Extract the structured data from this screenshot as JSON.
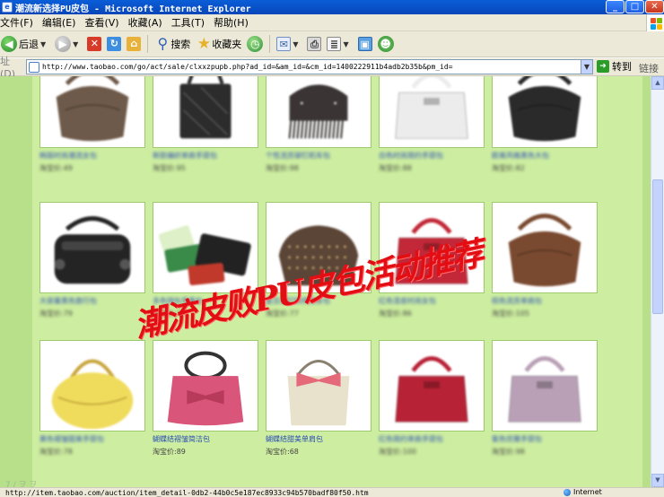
{
  "window": {
    "title": "潮流新选择PU皮包 - Microsoft Internet Explorer",
    "controls": {
      "minimize": "_",
      "maximize": "□",
      "close": "✕"
    }
  },
  "menu": [
    "文件(F)",
    "编辑(E)",
    "查看(V)",
    "收藏(A)",
    "工具(T)",
    "帮助(H)"
  ],
  "toolbar": {
    "back_label": "后退",
    "search_label": "搜索",
    "favorites_label": "收藏夹"
  },
  "address": {
    "label": "址(D)",
    "url": "http://www.taobao.com/go/act/sale/clxxzpupb.php?ad_id=&am_id=&cm_id=1400222911b4adb2b35b&pm_id=",
    "go_label": "转到",
    "links_label": "链接"
  },
  "overlay_text": "潮流皮败PU皮包活动推荐",
  "products": [
    {
      "name": "韩版时尚潮流女包",
      "price": "淘宝价:49",
      "shape": "hobo",
      "color": "#6e5a4a"
    },
    {
      "name": "新款编织单肩手提包",
      "price": "淘宝价:95",
      "shape": "tote",
      "color": "#2c2c2c"
    },
    {
      "name": "个性流苏铆钉机车包",
      "price": "淘宝价:98",
      "shape": "fringe",
      "color": "#3a3434"
    },
    {
      "name": "白色时尚简约手提包",
      "price": "淘宝价:88",
      "shape": "satchel",
      "color": "#ececec"
    },
    {
      "name": "欧美风格黑色大包",
      "price": "淘宝价:82",
      "shape": "hobo",
      "color": "#2a2a2a"
    },
    {
      "name": "大容量黑色旅行包",
      "price": "淘宝价:79",
      "shape": "duffel",
      "color": "#242424"
    },
    {
      "name": "多色钱包手拿包",
      "price": "淘宝价:39",
      "shape": "wallet",
      "color": "#3a8a4a"
    },
    {
      "name": "复古铆钉斜挎链条包",
      "price": "淘宝价:77",
      "shape": "clutch",
      "color": "#5b4536"
    },
    {
      "name": "红色漆皮时尚女包",
      "price": "淘宝价:86",
      "shape": "satchel",
      "color": "#c22837"
    },
    {
      "name": "棕色流苏单肩包",
      "price": "淘宝价:105",
      "shape": "hobo",
      "color": "#7a4a30"
    },
    {
      "name": "黄色褶皱甜美手提包",
      "price": "淘宝价:78",
      "shape": "round",
      "color": "#f0dc5c"
    },
    {
      "name": "蝴蝶结褶皱简洁包",
      "price": "淘宝价:89",
      "shape": "bow",
      "color": "#d9557a"
    },
    {
      "name": "蝴蝶结甜美单肩包",
      "price": "淘宝价:68",
      "shape": "bowbag",
      "color": "#e8e2cc"
    },
    {
      "name": "红色简约单肩手提包",
      "price": "淘宝价:100",
      "shape": "satchel",
      "color": "#b82236"
    },
    {
      "name": "紫色优雅手提包",
      "price": "淘宝价:98",
      "shape": "satchel",
      "color": "#b9a0b6"
    }
  ],
  "status": {
    "url": "http://item.taobao.com/auction/item_detail-0db2-44b0c5e187ec8933c94b570badf80f50.htm",
    "zone": "Internet",
    "ghost": "7 / ヲ ヲ"
  }
}
